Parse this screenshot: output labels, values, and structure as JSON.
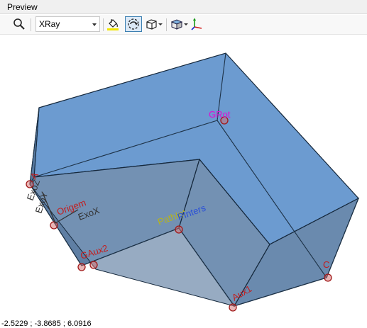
{
  "panel": {
    "title": "Preview"
  },
  "toolbar": {
    "zoom_icon": "magnifier-icon",
    "render_mode": "XRay",
    "render_mode_options": [
      "XRay"
    ],
    "fill_icon": "paint-bucket-icon",
    "rotate_icon": "rotate-view-icon",
    "box_icon": "wireframe-box-icon",
    "view_cube_icon": "view-cube-icon",
    "axes_icon": "axes-icon"
  },
  "colors": {
    "solid_fill": "#4f86c2",
    "edge": "#15283c",
    "label_magenta": "#d21fd2",
    "label_red": "#c41c1c",
    "label_dark": "#333333",
    "label_yellow": "#b8b418",
    "label_blue": "#2a4fd8"
  },
  "viewport": {
    "labels": {
      "grot": "GRot",
      "origem": "Origem",
      "exox": "ExoX",
      "exoy": "ExoY",
      "exoz": "ExoZ",
      "a": "A",
      "gaux2": "GAux2",
      "pathint": "PathInt",
      "pinters": "PInters",
      "aux1": "Aux1",
      "c": "C"
    },
    "coordinate_readout": "-2.5229 ; -3.8685 ; 6.0916"
  }
}
